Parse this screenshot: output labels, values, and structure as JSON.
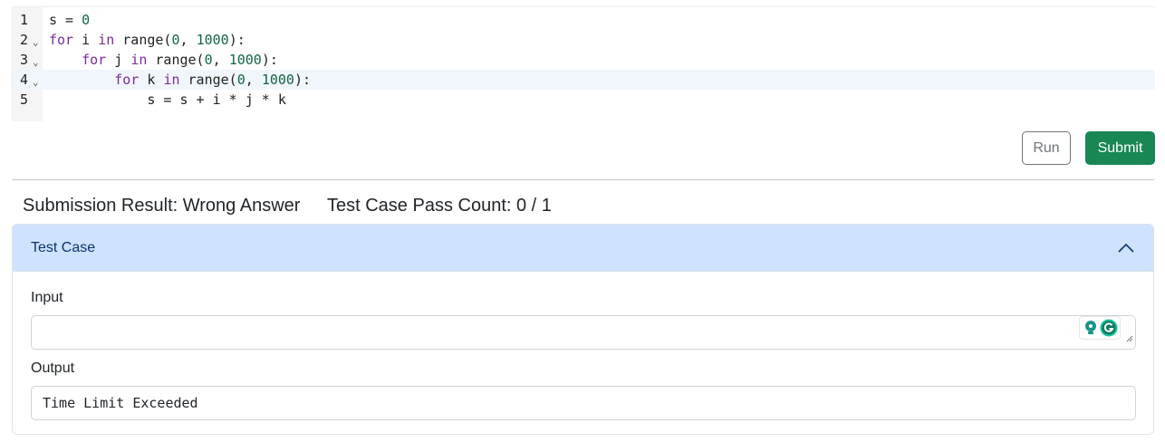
{
  "editor": {
    "lines": [
      {
        "num": "1",
        "fold": "",
        "indent": "",
        "tokens": [
          [
            "s = ",
            ""
          ],
          [
            "0",
            "num"
          ]
        ]
      },
      {
        "num": "2",
        "fold": "⌄",
        "indent": "",
        "tokens": [
          [
            "for",
            "kw"
          ],
          [
            " i ",
            ""
          ],
          [
            "in",
            "kw"
          ],
          [
            " range(",
            ""
          ],
          [
            "0",
            "num"
          ],
          [
            ", ",
            ""
          ],
          [
            "1000",
            "num"
          ],
          [
            "):",
            ""
          ]
        ]
      },
      {
        "num": "3",
        "fold": "⌄",
        "indent": "    ",
        "tokens": [
          [
            "for",
            "kw"
          ],
          [
            " j ",
            ""
          ],
          [
            "in",
            "kw"
          ],
          [
            " range(",
            ""
          ],
          [
            "0",
            "num"
          ],
          [
            ", ",
            ""
          ],
          [
            "1000",
            "num"
          ],
          [
            "):",
            ""
          ]
        ]
      },
      {
        "num": "4",
        "fold": "⌄",
        "indent": "        ",
        "tokens": [
          [
            "for",
            "kw"
          ],
          [
            " k ",
            ""
          ],
          [
            "in",
            "kw"
          ],
          [
            " range(",
            ""
          ],
          [
            "0",
            "num"
          ],
          [
            ", ",
            ""
          ],
          [
            "1000",
            "num"
          ],
          [
            "):",
            ""
          ]
        ]
      },
      {
        "num": "5",
        "fold": "",
        "indent": "            ",
        "tokens": [
          [
            "s = s + i * j * k",
            ""
          ]
        ]
      }
    ],
    "active_line": 4
  },
  "buttons": {
    "run_label": "Run",
    "submit_label": "Submit"
  },
  "result": {
    "submission_result": "Submission Result: Wrong Answer",
    "pass_count": "Test Case Pass Count: 0 / 1"
  },
  "test_case": {
    "title": "Test Case",
    "input_label": "Input",
    "input_value": "",
    "output_label": "Output",
    "output_value": "Time Limit Exceeded"
  },
  "colors": {
    "accent": "#198754",
    "accordion_header": "#cfe2ff",
    "keyword": "#7a2b9b",
    "number": "#116644"
  },
  "icons": {
    "fold": "chevron-down-icon",
    "accordion_toggle": "chevron-up-icon",
    "extension_1": "lightbulb-icon",
    "extension_2": "grammarly-icon"
  }
}
